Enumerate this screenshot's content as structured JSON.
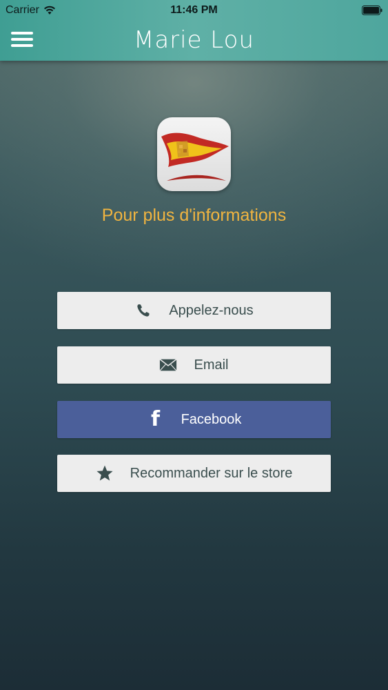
{
  "status_bar": {
    "carrier": "Carrier",
    "time": "11:46 PM"
  },
  "nav": {
    "title": "Marie Lou"
  },
  "main": {
    "heading": "Pour plus d'informations",
    "buttons": {
      "call": "Appelez-nous",
      "email": "Email",
      "facebook": "Facebook",
      "store": "Recommander sur le store"
    }
  },
  "icons": {
    "menu": "hamburger-menu-icon",
    "call": "phone-icon",
    "email": "envelope-icon",
    "facebook": "facebook-icon",
    "store": "star-icon",
    "app": "flag-logo-icon"
  },
  "colors": {
    "nav_bar": "#5fb0a6",
    "heading": "#f0b440",
    "button": "#ededed",
    "facebook_button": "#4b5f9a"
  }
}
